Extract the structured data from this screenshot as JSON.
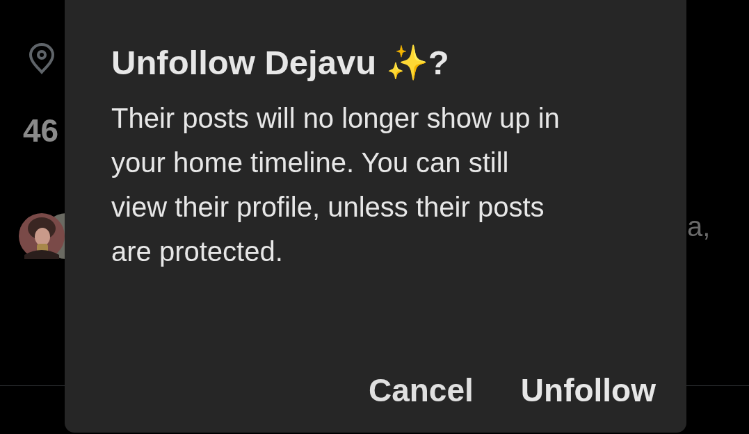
{
  "background": {
    "stat": "46",
    "text_fragment": "a,"
  },
  "dialog": {
    "title": "Unfollow Dejavu ✨?",
    "message": "Their posts will no longer show up in your home timeline. You can still view their profile, unless their posts are protected.",
    "buttons": [
      {
        "label": "Cancel",
        "kind": "cancel"
      },
      {
        "label": "Unfollow",
        "kind": "confirm"
      }
    ]
  }
}
